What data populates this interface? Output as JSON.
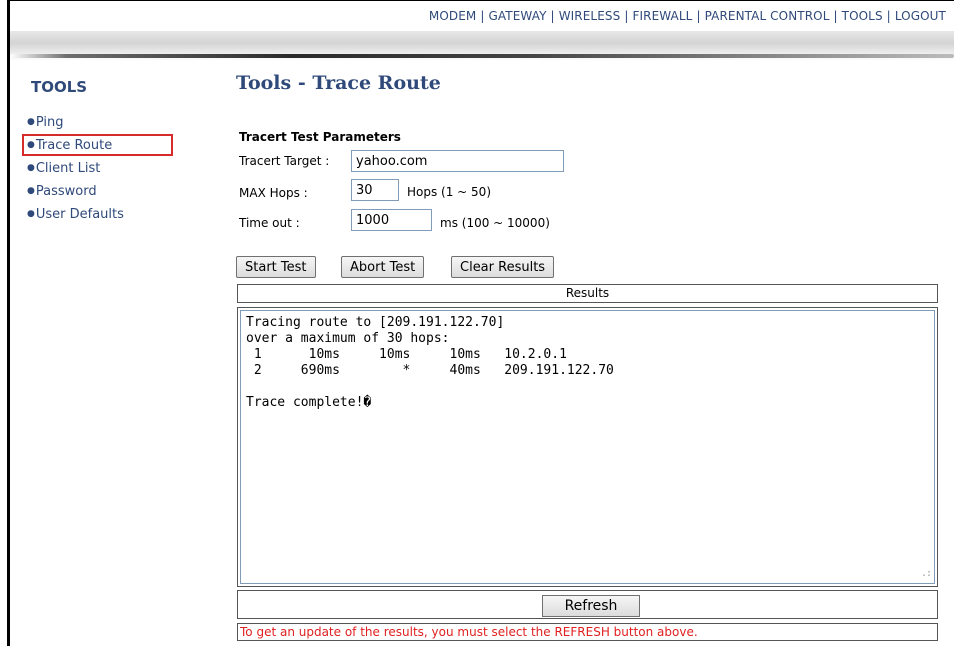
{
  "nav": {
    "items": [
      "MODEM",
      "GATEWAY",
      "WIRELESS",
      "FIREWALL",
      "PARENTAL CONTROL",
      "TOOLS",
      "LOGOUT"
    ]
  },
  "sidebar": {
    "title": "TOOLS",
    "items": [
      {
        "label": "Ping"
      },
      {
        "label": "Trace Route"
      },
      {
        "label": "Client List"
      },
      {
        "label": "Password"
      },
      {
        "label": "User Defaults"
      }
    ],
    "active_item": "Trace Route"
  },
  "page": {
    "title": "Tools - Trace Route",
    "section_title": "Tracert Test Parameters"
  },
  "form": {
    "target_label": "Tracert Target :",
    "target_value": "yahoo.com",
    "hops_label": "MAX Hops :",
    "hops_value": "30",
    "hops_hint": "Hops (1 ~ 50)",
    "timeout_label": "Time out :",
    "timeout_value": "1000",
    "timeout_hint": "ms (100 ~ 10000)"
  },
  "buttons": {
    "start": "Start Test",
    "abort": "Abort Test",
    "clear": "Clear Results",
    "refresh": "Refresh"
  },
  "results": {
    "header": "Results",
    "lines": [
      "Tracing route to [209.191.122.70]",
      "over a maximum of 30 hops:",
      " 1      10ms     10ms     10ms   10.2.0.1",
      " 2     690ms        *     40ms   209.191.122.70",
      "",
      "Trace complete!�"
    ]
  },
  "note": "To get an update of the results, you must select the REFRESH button above.",
  "colors": {
    "link": "#2f4a7a",
    "highlight": "#d62b2b",
    "note": "#e02020"
  }
}
